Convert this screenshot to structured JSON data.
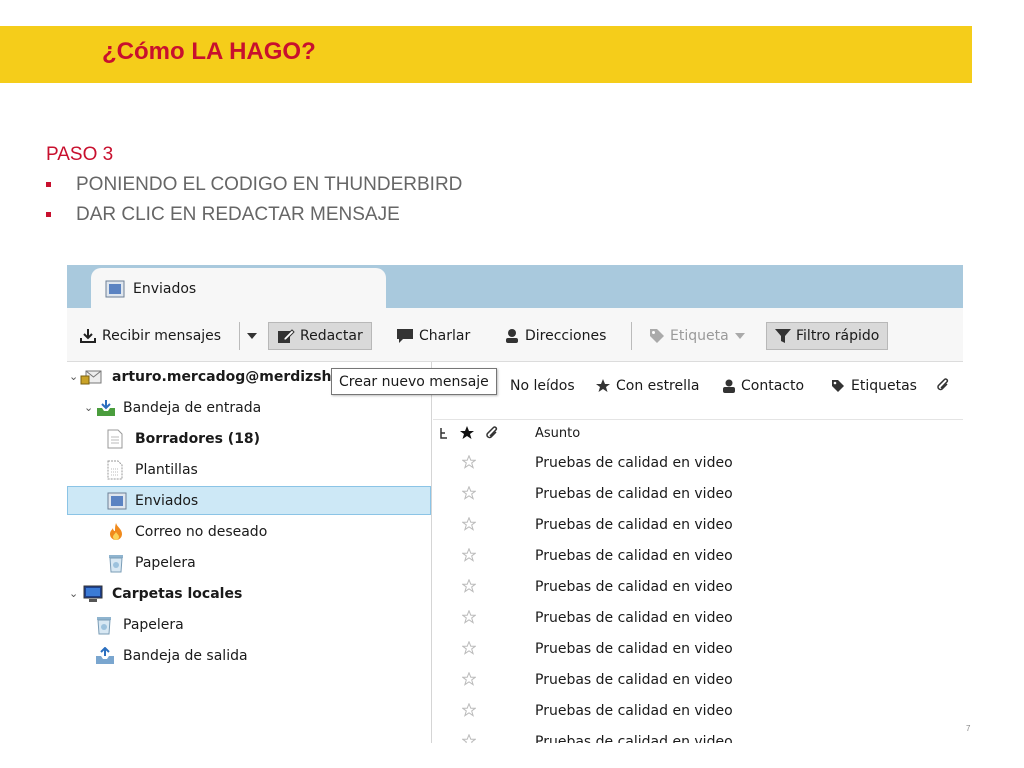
{
  "slide": {
    "title": "¿Cómo LA HAGO?",
    "step": "PASO 3",
    "bullets": [
      "PONIENDO EL CODIGO EN THUNDERBIRD",
      "DAR CLIC EN REDACTAR MENSAJE"
    ],
    "page_number": "7"
  },
  "thunderbird": {
    "tab_label": "Enviados",
    "toolbar": {
      "get_messages": "Recibir mensajes",
      "write": "Redactar",
      "chat": "Charlar",
      "address_book": "Direcciones",
      "tag": "Etiqueta",
      "quick_filter": "Filtro rápido"
    },
    "tooltip": "Crear nuevo mensaje",
    "folders": {
      "account": "arturo.mercadog@merdizsh",
      "inbox": "Bandeja de entrada",
      "drafts": "Borradores (18)",
      "templates": "Plantillas",
      "sent": "Enviados",
      "junk": "Correo no deseado",
      "trash": "Papelera",
      "local_folders": "Carpetas locales",
      "local_trash": "Papelera",
      "outbox": "Bandeja de salida"
    },
    "quick_filter_bar": {
      "unread": "No leídos",
      "starred": "Con estrella",
      "contact": "Contacto",
      "tags": "Etiquetas"
    },
    "columns": {
      "subject": "Asunto"
    },
    "messages": [
      "Pruebas de calidad en video",
      "Pruebas de calidad en video",
      "Pruebas de calidad en video",
      "Pruebas de calidad en video",
      "Pruebas de calidad en video",
      "Pruebas de calidad en video",
      "Pruebas de calidad en video",
      "Pruebas de calidad en video",
      "Pruebas de calidad en video",
      "Pruebas de calidad en video"
    ]
  },
  "colors": {
    "banner": "#f5cd1a",
    "title_red": "#c8102e",
    "tab_bar": "#a9c9dd",
    "selection": "#cde8f6"
  }
}
